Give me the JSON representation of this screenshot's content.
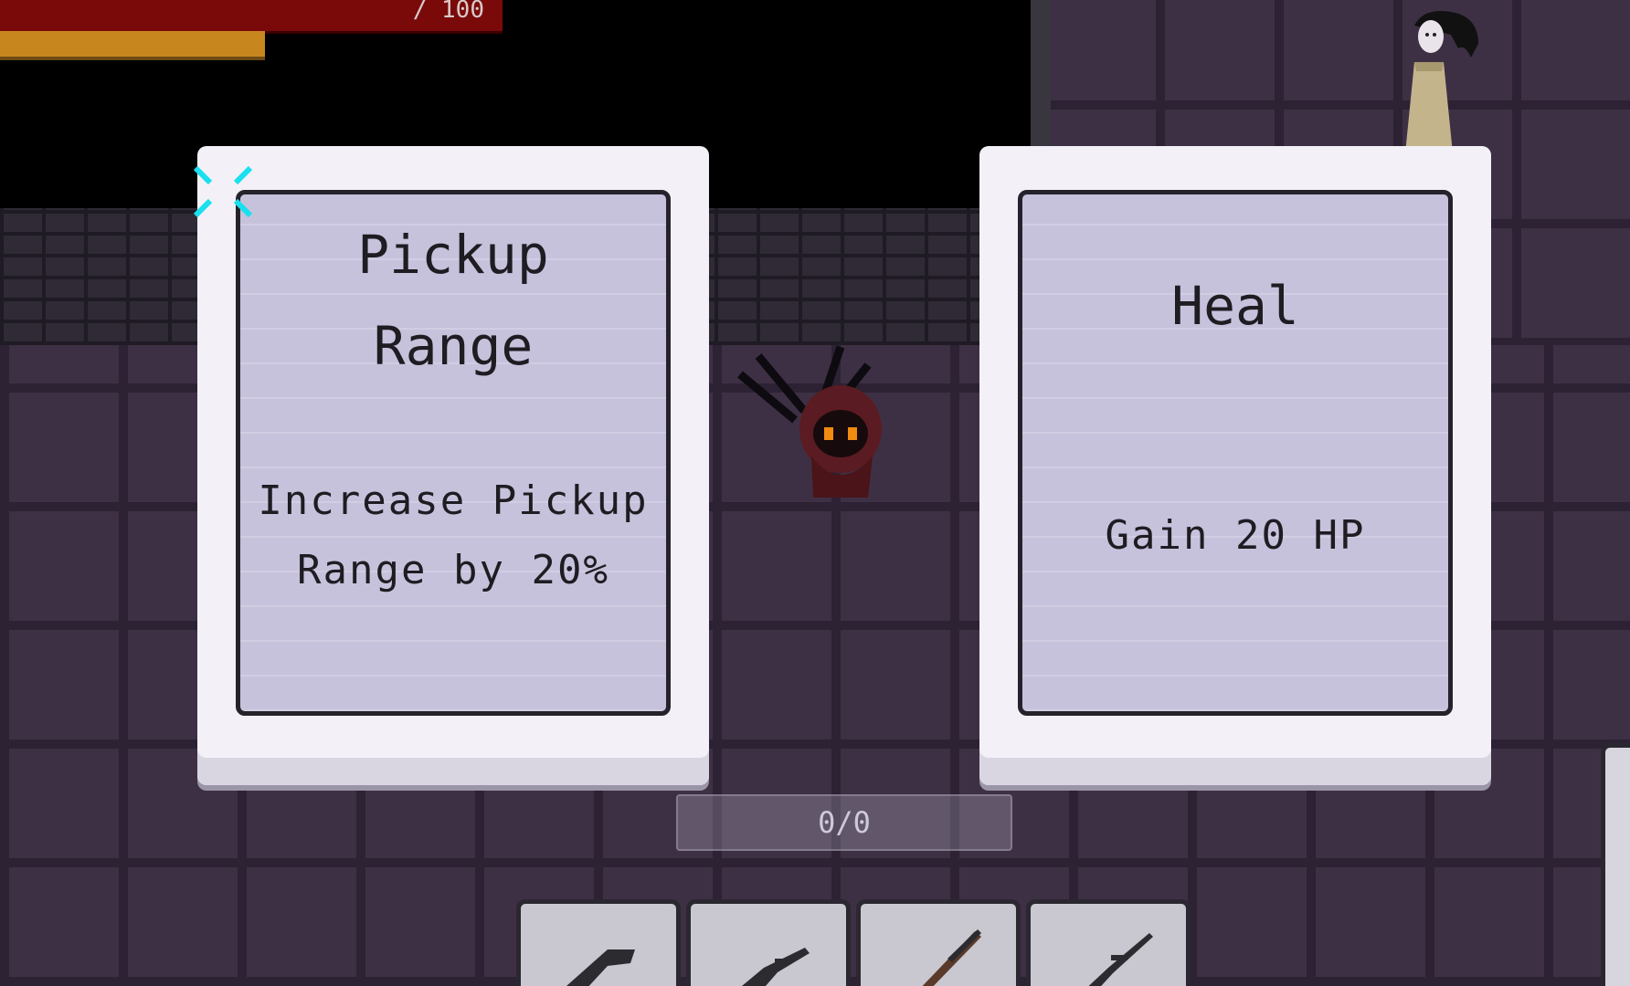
{
  "hud": {
    "hp_text": "/ 100",
    "hp_color": "#7a0a0a",
    "xp_color": "#c8861f"
  },
  "upgrade_cards": [
    {
      "title": "Pickup\nRange",
      "description": "Increase Pickup\nRange by 20%"
    },
    {
      "title": "Heal",
      "description": "Gain 20 HP"
    }
  ],
  "selection_indicator_icon": "sparkle-icon",
  "counter": {
    "text": "0/0"
  },
  "hotbar": {
    "slots": [
      {
        "icon": "pistol-icon"
      },
      {
        "icon": "rifle-icon"
      },
      {
        "icon": "shotgun-icon"
      },
      {
        "icon": "sniper-icon"
      }
    ]
  },
  "characters": {
    "player_icon": "hooded-devil-icon",
    "enemy_icon": "ghost-girl-icon"
  }
}
